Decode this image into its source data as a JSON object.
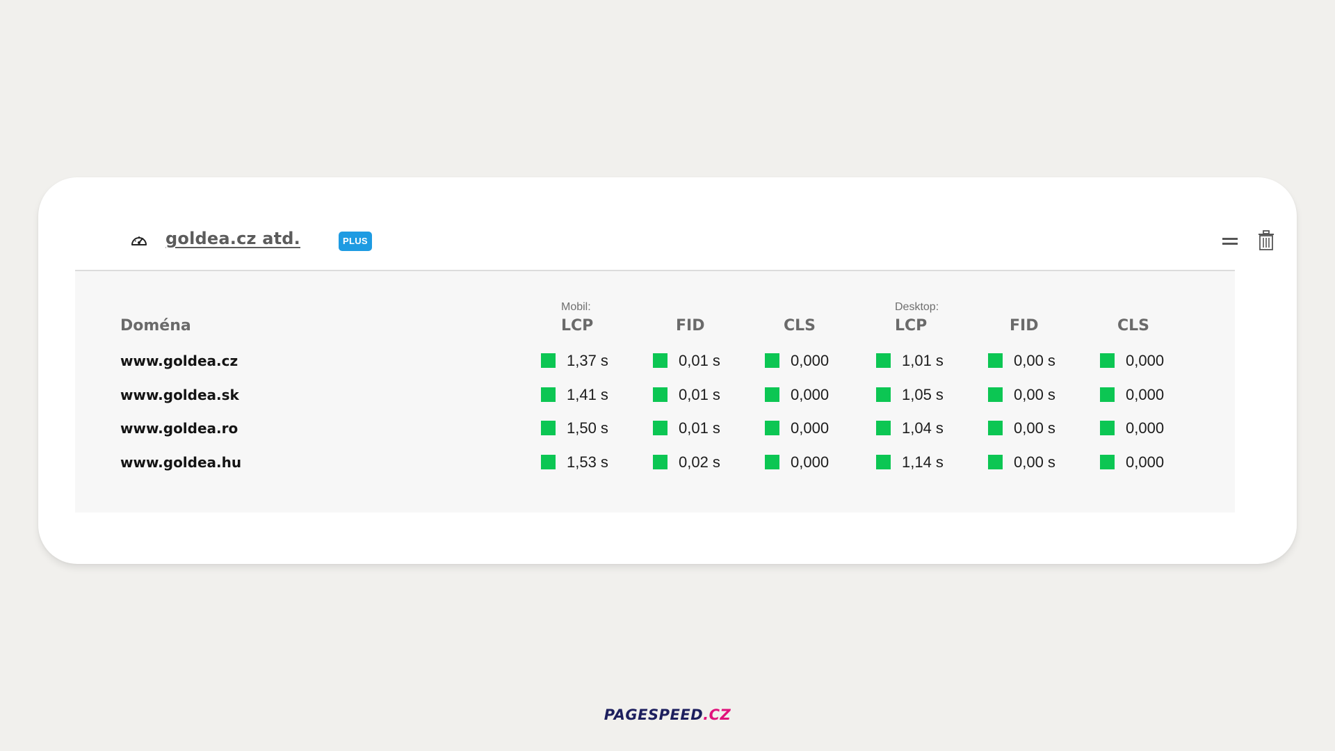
{
  "card": {
    "title": "goldea.cz atd.",
    "badge": "PLUS"
  },
  "table": {
    "domain_header": "Doména",
    "mobile_group": "Mobil:",
    "desktop_group": "Desktop:",
    "columns": [
      "LCP",
      "FID",
      "CLS",
      "LCP",
      "FID",
      "CLS"
    ],
    "rows": [
      {
        "domain": "www.goldea.cz",
        "values": [
          "1,37 s",
          "0,01 s",
          "0,000",
          "1,01 s",
          "0,00 s",
          "0,000"
        ]
      },
      {
        "domain": "www.goldea.sk",
        "values": [
          "1,41 s",
          "0,01 s",
          "0,000",
          "1,05 s",
          "0,00 s",
          "0,000"
        ]
      },
      {
        "domain": "www.goldea.ro",
        "values": [
          "1,50 s",
          "0,01 s",
          "0,000",
          "1,04 s",
          "0,00 s",
          "0,000"
        ]
      },
      {
        "domain": "www.goldea.hu",
        "values": [
          "1,53 s",
          "0,02 s",
          "0,000",
          "1,14 s",
          "0,00 s",
          "0,000"
        ]
      }
    ],
    "status_color": "#0cc653"
  },
  "footer": {
    "brand_main": "PAGESPEED",
    "brand_tld": ".CZ"
  },
  "icons": [
    "gauge-icon",
    "drag-handle-icon",
    "trash-icon"
  ]
}
